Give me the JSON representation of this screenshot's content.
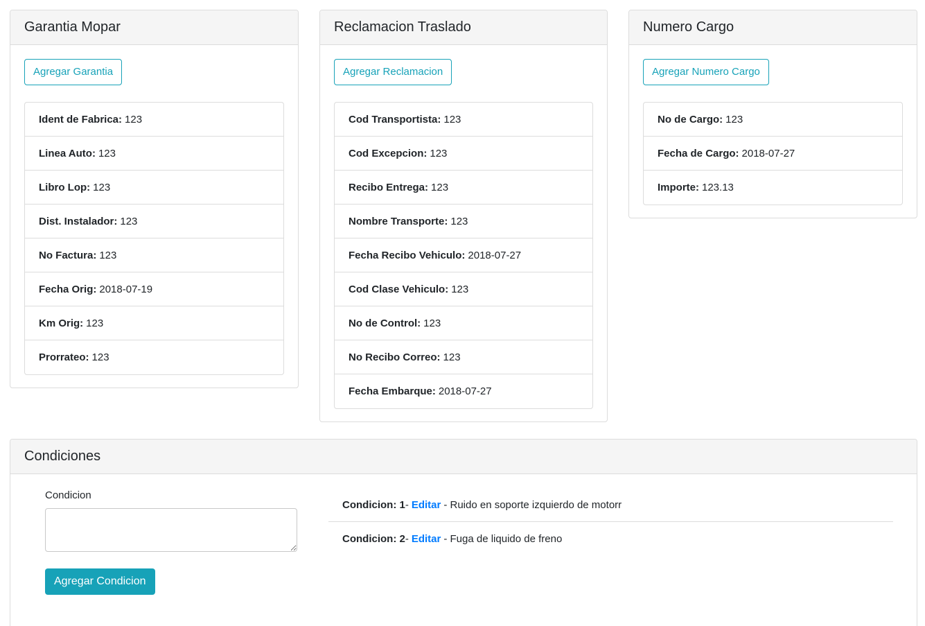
{
  "garantia": {
    "title": "Garantia Mopar",
    "button": "Agregar Garantia",
    "items": [
      {
        "label": "Ident de Fabrica:",
        "value": "123"
      },
      {
        "label": "Linea Auto:",
        "value": "123"
      },
      {
        "label": "Libro Lop:",
        "value": "123"
      },
      {
        "label": "Dist. Instalador:",
        "value": "123"
      },
      {
        "label": "No Factura:",
        "value": "123"
      },
      {
        "label": "Fecha Orig:",
        "value": "2018-07-19"
      },
      {
        "label": "Km Orig:",
        "value": "123"
      },
      {
        "label": "Prorrateo:",
        "value": "123"
      }
    ]
  },
  "reclamacion": {
    "title": "Reclamacion Traslado",
    "button": "Agregar Reclamacion",
    "items": [
      {
        "label": "Cod Transportista:",
        "value": "123"
      },
      {
        "label": "Cod Excepcion:",
        "value": "123"
      },
      {
        "label": "Recibo Entrega:",
        "value": "123"
      },
      {
        "label": "Nombre Transporte:",
        "value": "123"
      },
      {
        "label": "Fecha Recibo Vehiculo:",
        "value": "2018-07-27"
      },
      {
        "label": "Cod Clase Vehiculo:",
        "value": "123"
      },
      {
        "label": "No de Control:",
        "value": "123"
      },
      {
        "label": "No Recibo Correo:",
        "value": "123"
      },
      {
        "label": "Fecha Embarque:",
        "value": "2018-07-27"
      }
    ]
  },
  "cargo": {
    "title": "Numero Cargo",
    "button": "Agregar Numero Cargo",
    "items": [
      {
        "label": "No de Cargo:",
        "value": "123"
      },
      {
        "label": "Fecha de Cargo:",
        "value": "2018-07-27"
      },
      {
        "label": "Importe:",
        "value": "123.13"
      }
    ]
  },
  "condiciones": {
    "title": "Condiciones",
    "field_label": "Condicion",
    "textarea_value": "",
    "button": "Agregar Condicion",
    "edit_label": "Editar",
    "items": [
      {
        "label": "Condicion: 1",
        "text": "- Ruido en soporte izquierdo de motorr"
      },
      {
        "label": "Condicion: 2",
        "text": "- Fuga de liquido de freno"
      }
    ]
  },
  "colors": {
    "accent": "#17a2b8",
    "link": "#007bff",
    "header_bg": "#f5f5f5",
    "border": "#dcdcdc"
  }
}
